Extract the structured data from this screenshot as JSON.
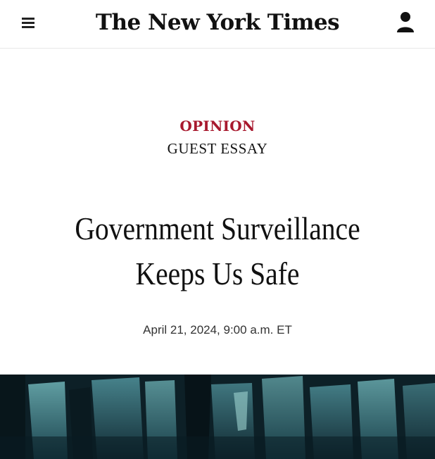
{
  "header": {
    "menu_icon": "hamburger-menu-icon",
    "logo": "The New York Times",
    "account_icon": "user-account-icon"
  },
  "article": {
    "section": "OPINION",
    "label": "GUEST ESSAY",
    "headline": "Government Surveillance\nKeeps Us Safe",
    "dateline": "April 21, 2024, 9:00 a.m. ET",
    "accent_color": "#a8192e"
  }
}
